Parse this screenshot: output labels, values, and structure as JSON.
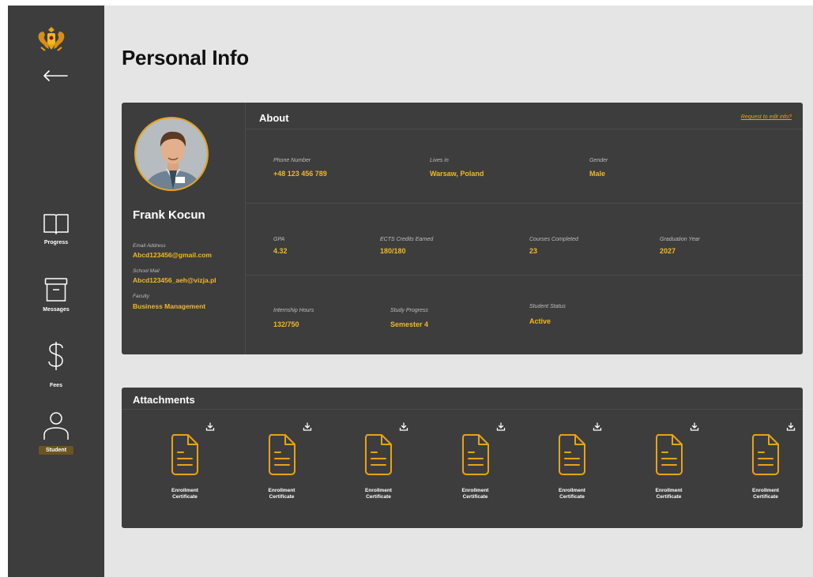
{
  "page": {
    "title": "Personal Info"
  },
  "sidebar": {
    "items": [
      {
        "label": "Progress",
        "icon": "book-icon"
      },
      {
        "label": "Messages",
        "icon": "archive-icon"
      },
      {
        "label": "Fees",
        "icon": "dollar-icon"
      },
      {
        "label": "Student",
        "icon": "user-icon",
        "active": true
      }
    ]
  },
  "profile": {
    "name": "Frank Kocun",
    "email_label": "Email Address",
    "email": "Abcd123456@gmail.com",
    "school_mail_label": "School Mail",
    "school_mail": "Abcd123456_aeh@vizja.pl",
    "faculty_label": "Faculty",
    "faculty": "Business Management"
  },
  "about": {
    "title": "About",
    "edit_link": "Request to edit info?",
    "row1": [
      {
        "label": "Phone Number",
        "value": "+48 123 456 789"
      },
      {
        "label": "Lives in",
        "value": "Warsaw, Poland"
      },
      {
        "label": "Gender",
        "value": "Male"
      }
    ],
    "row2": [
      {
        "label": "GPA",
        "value": "4.32"
      },
      {
        "label": "ECTS Credits Earned",
        "value": "180/180"
      },
      {
        "label": "Courses Completed",
        "value": "23"
      },
      {
        "label": "Graduation Year",
        "value": "2027"
      }
    ],
    "row3": [
      {
        "label": "Internship Hours",
        "value": "132/750"
      },
      {
        "label": "Study Progress",
        "value": "Semester 4"
      },
      {
        "label": "Student Status",
        "value": "Active"
      }
    ]
  },
  "attachments": {
    "title": "Attachments",
    "items": [
      {
        "label": "Enrollment Certificate"
      },
      {
        "label": "Enrollment Certificate"
      },
      {
        "label": "Enrollment Certificate"
      },
      {
        "label": "Enrollment Certificate"
      },
      {
        "label": "Enrollment Certificate"
      },
      {
        "label": "Enrollment Certificate"
      },
      {
        "label": "Enrollment Certificate"
      }
    ]
  },
  "colors": {
    "accent": "#e8a317",
    "panel": "#3d3d3d",
    "background": "#e5e5e5",
    "badge": "#6b5420"
  }
}
